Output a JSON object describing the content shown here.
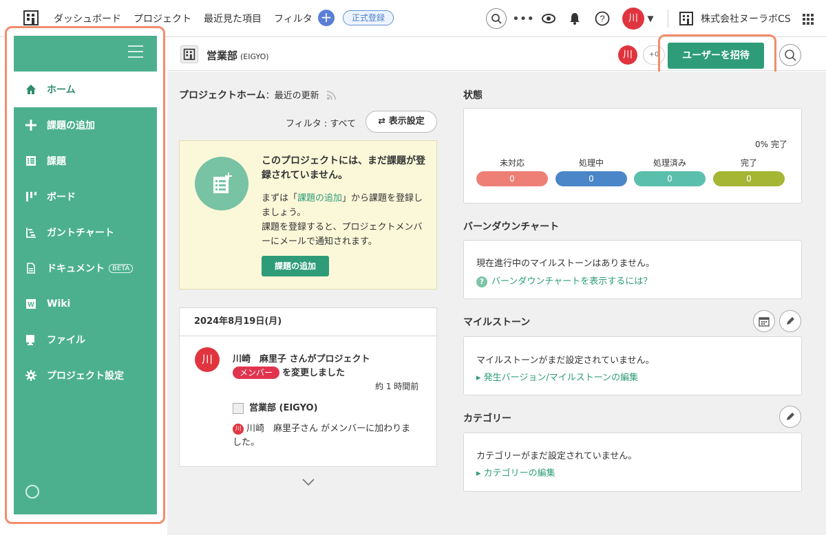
{
  "topnav": {
    "links": [
      "ダッシュボード",
      "プロジェクト",
      "最近見た項目",
      "フィルタ"
    ],
    "add_label": "+",
    "register_label": "正式登録",
    "user_initial": "川",
    "org_name": "株式会社ヌーラボCS",
    "icons": [
      "search-icon",
      "more-icon",
      "eye-icon",
      "bell-icon",
      "help-icon",
      "grid-icon"
    ]
  },
  "sidebar": {
    "items": [
      {
        "label": "ホーム",
        "icon": "home-icon"
      },
      {
        "label": "課題の追加",
        "icon": "plus-icon"
      },
      {
        "label": "課題",
        "icon": "list-icon"
      },
      {
        "label": "ボード",
        "icon": "board-icon"
      },
      {
        "label": "ガントチャート",
        "icon": "gantt-icon"
      },
      {
        "label": "ドキュメント",
        "icon": "document-icon",
        "badge": "BETA"
      },
      {
        "label": "Wiki",
        "icon": "wiki-icon"
      },
      {
        "label": "ファイル",
        "icon": "file-icon"
      },
      {
        "label": "プロジェクト設定",
        "icon": "gear-icon"
      }
    ]
  },
  "project": {
    "name": "営業部",
    "key": "(EIGYO)",
    "member_avatar": "川",
    "extra_members": "+0",
    "invite_label": "ユーザーを招待"
  },
  "home": {
    "title": "プロジェクトホーム",
    "subtitle": "：最近の更新",
    "filter_label": "フィルタ : すべて",
    "display_settings": "表示設定",
    "empty_title": "このプロジェクトには、まだ課題が登録されていません。",
    "empty_text_pre": "まずは「",
    "empty_text_link": "課題の追加",
    "empty_text_post": "」から課題を登録しましょう。",
    "empty_text_2": "課題を登録すると、プロジェクトメンバーにメールで通知されます。",
    "add_issue_button": "課題の追加"
  },
  "activity": {
    "date": "2024年8月19日(月)",
    "avatar": "川",
    "line1": "川崎　麻里子 さんがプロジェクト",
    "badge": "メンバー",
    "line2": "を変更しました",
    "time": "約 1 時間前",
    "project": "営業部 (EIGYO)",
    "detail_avatar": "川",
    "detail": "川崎　麻里子さん がメンバーに加わりました。"
  },
  "status": {
    "title": "状態",
    "percent": "0% 完了",
    "items": [
      {
        "label": "未対応",
        "value": "0",
        "color": "#ee7f76"
      },
      {
        "label": "処理中",
        "value": "0",
        "color": "#4a86c8"
      },
      {
        "label": "処理済み",
        "value": "0",
        "color": "#5bbfae"
      },
      {
        "label": "完了",
        "value": "0",
        "color": "#a4b634"
      }
    ]
  },
  "burndown": {
    "title": "バーンダウンチャート",
    "text": "現在進行中のマイルストーンはありません。",
    "link": "バーンダウンチャートを表示するには？"
  },
  "milestone": {
    "title": "マイルストーン",
    "text": "マイルストーンがまだ設定されていません。",
    "link": "▸ 発生バージョン/マイルストーンの編集"
  },
  "category": {
    "title": "カテゴリー",
    "text": "カテゴリーがまだ設定されていません。",
    "link": "▸ カテゴリーの編集"
  }
}
